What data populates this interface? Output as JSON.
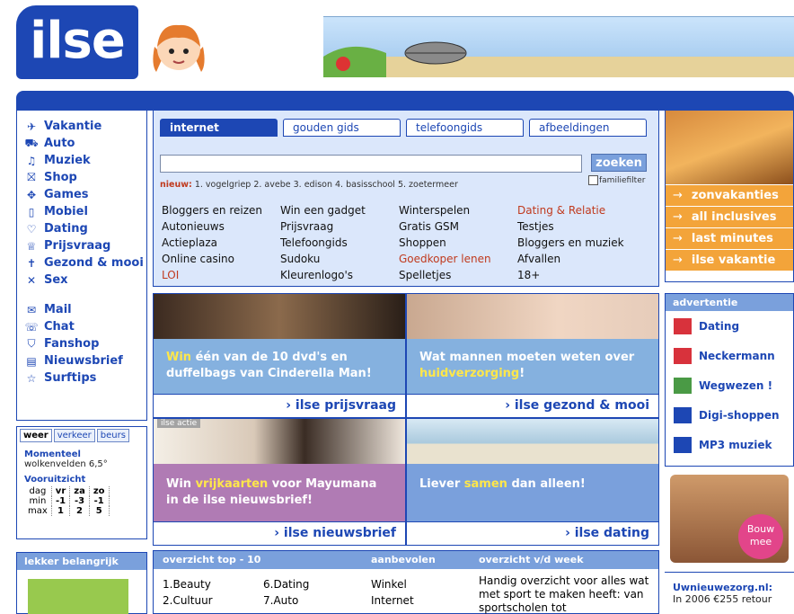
{
  "header": {
    "logo_text": "ilse"
  },
  "leftnav": {
    "group1": [
      {
        "label": "Vakantie",
        "icon": "plane-icon"
      },
      {
        "label": "Auto",
        "icon": "car-icon"
      },
      {
        "label": "Muziek",
        "icon": "music-icon"
      },
      {
        "label": "Shop",
        "icon": "cart-icon"
      },
      {
        "label": "Games",
        "icon": "gamepad-icon"
      },
      {
        "label": "Mobiel",
        "icon": "mobile-icon"
      },
      {
        "label": "Dating",
        "icon": "heart-icon"
      },
      {
        "label": "Prijsvraag",
        "icon": "trophy-icon"
      },
      {
        "label": "Gezond & mooi",
        "icon": "person-icon"
      },
      {
        "label": "Sex",
        "icon": "x-icon"
      }
    ],
    "group2": [
      {
        "label": "Mail",
        "icon": "envelope-icon"
      },
      {
        "label": "Chat",
        "icon": "chat-icon"
      },
      {
        "label": "Fanshop",
        "icon": "shirt-icon"
      },
      {
        "label": "Nieuwsbrief",
        "icon": "newsletter-icon"
      },
      {
        "label": "Surftips",
        "icon": "star-icon"
      }
    ]
  },
  "weer": {
    "tabs": [
      "weer",
      "verkeer",
      "beurs"
    ],
    "momenteel_label": "Momenteel",
    "momenteel_value": "wolkenvelden 6,5°",
    "vooruitzicht_label": "Vooruitzicht",
    "rows": [
      [
        "dag",
        "vr",
        "za",
        "zo"
      ],
      [
        "min",
        "-1",
        "-3",
        "-1"
      ],
      [
        "max",
        "1",
        "2",
        "5"
      ]
    ]
  },
  "lekker": {
    "title": "lekker belangrijk"
  },
  "search": {
    "tabs": [
      "internet",
      "gouden gids",
      "telefoongids",
      "afbeeldingen"
    ],
    "button": "zoeken",
    "nieuw_label": "nieuw:",
    "nieuw_items": "1. vogelgriep   2. avebe   3. edison   4. basisschool   5. zoetermeer",
    "familiefilter": "familiefilter",
    "links": [
      [
        "Bloggers en reizen",
        "Win een gadget",
        "Winterspelen",
        "Dating & Relatie"
      ],
      [
        "Autonieuws",
        "Prijsvraag",
        "Gratis GSM",
        "Testjes"
      ],
      [
        "Actieplaza",
        "Telefoongids",
        "Shoppen",
        "Bloggers en muziek"
      ],
      [
        "Online casino",
        "Sudoku",
        "Goedkoper lenen",
        "Afvallen"
      ],
      [
        "LOI",
        "Kleurenlogo's",
        "Spelletjes",
        "18+"
      ]
    ]
  },
  "promos": {
    "p1": {
      "cap_pre": "Win",
      "cap_rest": " één van de 10 dvd's en duffelbags van Cinderella Man!",
      "link": "› ilse prijsvraag"
    },
    "p2": {
      "cap_pre": "Wat mannen moeten weten over ",
      "cap_hl": "huidverzorging",
      "cap_post": "!",
      "link": "› ilse gezond & mooi"
    },
    "p3": {
      "tag": "ilse actie",
      "cap_pre": "Win ",
      "cap_hl": "vrijkaarten",
      "cap_post": " voor Mayumana in de ilse nieuwsbrief!",
      "link": "› ilse nieuwsbrief"
    },
    "p4": {
      "cap_pre": "Liever ",
      "cap_hl": "samen",
      "cap_post": " dan alleen!",
      "link": "› ilse dating"
    }
  },
  "overview": {
    "headers": [
      "overzicht top - 10",
      "aanbevolen",
      "overzicht v/d week"
    ],
    "top1": [
      "1.Beauty",
      "2.Cultuur"
    ],
    "top2": [
      "6.Dating",
      "7.Auto"
    ],
    "aanbevolen": [
      "Winkel",
      "Internet"
    ],
    "week": "Handig overzicht voor alles wat met sport te maken heeft: van sportscholen tot"
  },
  "rightcol": {
    "sun_links": [
      "zonvakanties",
      "all inclusives",
      "last minutes",
      "ilse vakantie"
    ],
    "ads_title": "advertentie",
    "ads": [
      {
        "label": "Dating",
        "icon": "heart-icon",
        "color": "#d8323c"
      },
      {
        "label": "Neckermann",
        "icon": "neckermann-icon",
        "color": "#d8323c"
      },
      {
        "label": "Wegwezen !",
        "icon": "map-icon",
        "color": "#4a9a45"
      },
      {
        "label": "Digi-shoppen",
        "icon": "bag-icon",
        "color": "#1d47b4"
      },
      {
        "label": "MP3 muziek",
        "icon": "music-icon",
        "color": "#1d47b4"
      }
    ],
    "bouw_badge": "Bouw mee",
    "uw_title": "Uwnieuwezorg.nl:",
    "uw_text": "In 2006 €255 retour"
  }
}
